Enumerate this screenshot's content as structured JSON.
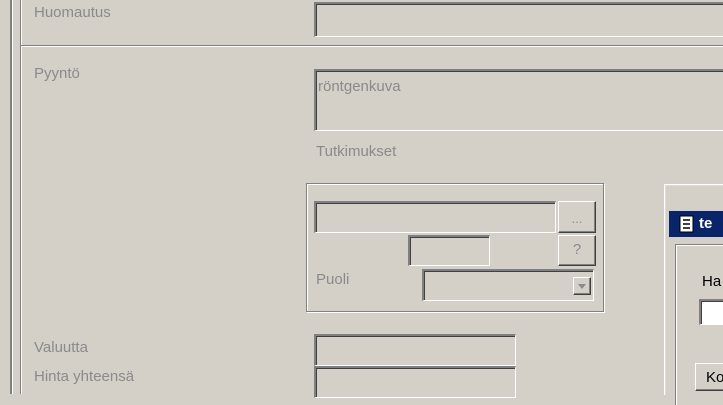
{
  "form": {
    "huomautus_label": "Huomautus",
    "pyynto_label": "Pyyntö",
    "pyynto_value": "röntgenkuva",
    "tutkimukset_label": "Tutkimukset",
    "browse_button_label": "...",
    "help_button_label": "?",
    "puoli_label": "Puoli",
    "valuutta_label": "Valuutta",
    "hinta_label": "Hinta yhteensä"
  },
  "dialog": {
    "title_partial": "te",
    "field_label_partial": "Ha",
    "button_label_partial": "Ko",
    "titlebar_color": "#0a246a"
  }
}
